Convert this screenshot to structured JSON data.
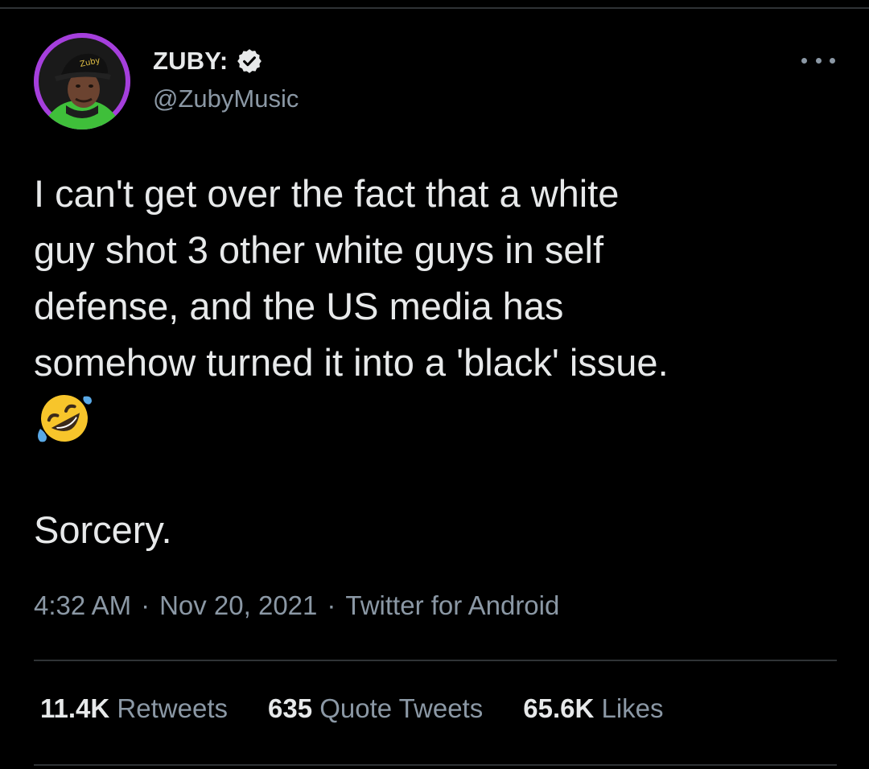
{
  "theme": {
    "background": "#000000",
    "text_primary": "#e7e9ea",
    "text_secondary": "#8b98a5",
    "divider": "#2f3336",
    "avatar_ring": "#a53fdc",
    "verified_badge": "#e7e9ea"
  },
  "author": {
    "display_name": "ZUBY:",
    "handle": "@ZubyMusic",
    "verified": true,
    "verified_icon": "verified-badge-icon",
    "avatar_icon": "profile-photo"
  },
  "header": {
    "more_icon": "more-options-icon"
  },
  "tweet": {
    "text": "I can't get over the fact that a white\nguy shot 3 other white guys in self\ndefense, and the US media has\nsomehow turned it into a 'black' issue.",
    "emoji": "🤣",
    "emoji_icon": "rolling-on-the-floor-laughing-emoji",
    "text_2": "Sorcery."
  },
  "meta": {
    "time": "4:32 AM",
    "separator": "·",
    "date": "Nov 20, 2021",
    "source": "Twitter for Android"
  },
  "stats": {
    "retweets": {
      "count": "11.4K",
      "label": "Retweets"
    },
    "quote_tweets": {
      "count": "635",
      "label": "Quote Tweets"
    },
    "likes": {
      "count": "65.6K",
      "label": "Likes"
    }
  }
}
